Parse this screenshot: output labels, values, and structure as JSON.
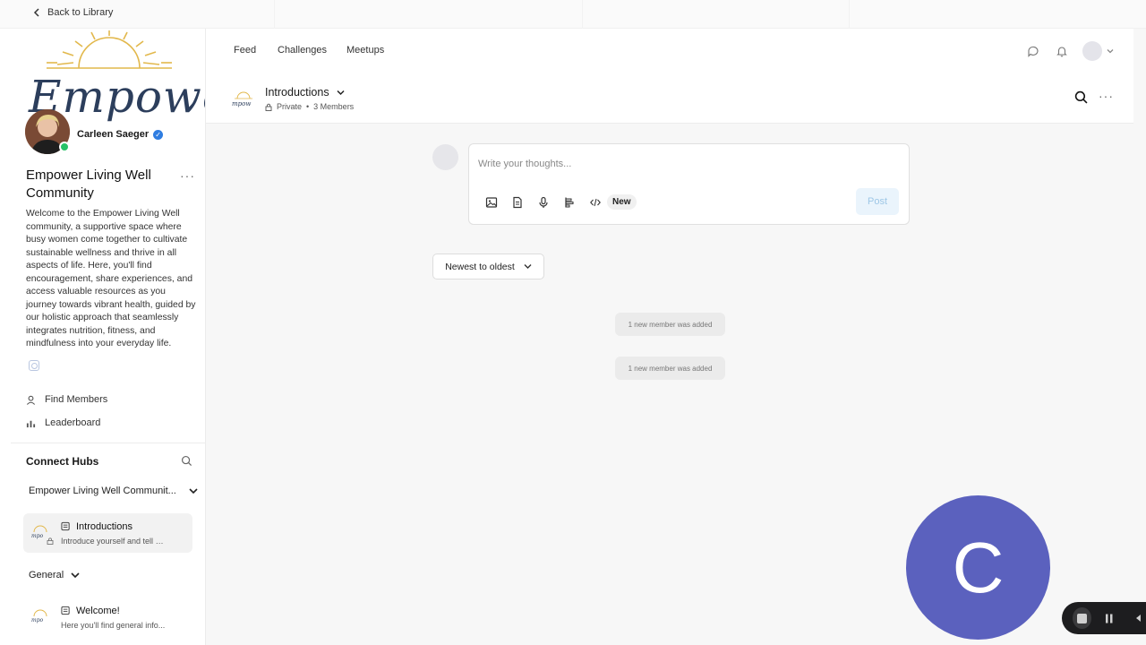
{
  "topbar": {
    "back_label": "Back to Library"
  },
  "sidebar": {
    "logo_text": "Empower",
    "owner_name": "Carleen Saeger",
    "community_title": "Empower Living Well Community",
    "description": "Welcome to the Empower Living Well community, a supportive space where busy women come together to cultivate sustainable wellness and thrive in all aspects of life. Here, you'll find encouragement, share experiences, and access valuable resources as you journey towards vibrant health, guided by our holistic approach that seamlessly integrates nutrition, fitness, and mindfulness into your everyday life.",
    "links": [
      {
        "label": "Find Members",
        "icon": "person-icon"
      },
      {
        "label": "Leaderboard",
        "icon": "bar-chart-icon"
      }
    ],
    "hubs_title": "Connect Hubs",
    "groups": [
      {
        "label": "Empower Living Well Communit...",
        "spaces": [
          {
            "name": "Introductions",
            "subtitle": "Introduce yourself and tell u...",
            "active": true
          }
        ]
      },
      {
        "label": "General",
        "spaces": [
          {
            "name": "Welcome!",
            "subtitle": "Here you'll find general info...",
            "active": false
          }
        ]
      }
    ]
  },
  "header": {
    "tabs": [
      "Feed",
      "Challenges",
      "Meetups"
    ],
    "space_title": "Introductions",
    "privacy": "Private",
    "members": "3 Members"
  },
  "composer": {
    "placeholder": "Write your thoughts...",
    "new_badge": "New",
    "post_label": "Post"
  },
  "feed": {
    "sort_label": "Newest to oldest",
    "notices": [
      "1 new member was added",
      "1 new member was added"
    ]
  },
  "overlay": {
    "avatar_letter": "C"
  },
  "colors": {
    "accent": "#2f7de1",
    "online": "#27c267",
    "avatar_bg": "#5b61be",
    "logo_navy": "#2c3e5c",
    "sun": "#e2b84c"
  }
}
